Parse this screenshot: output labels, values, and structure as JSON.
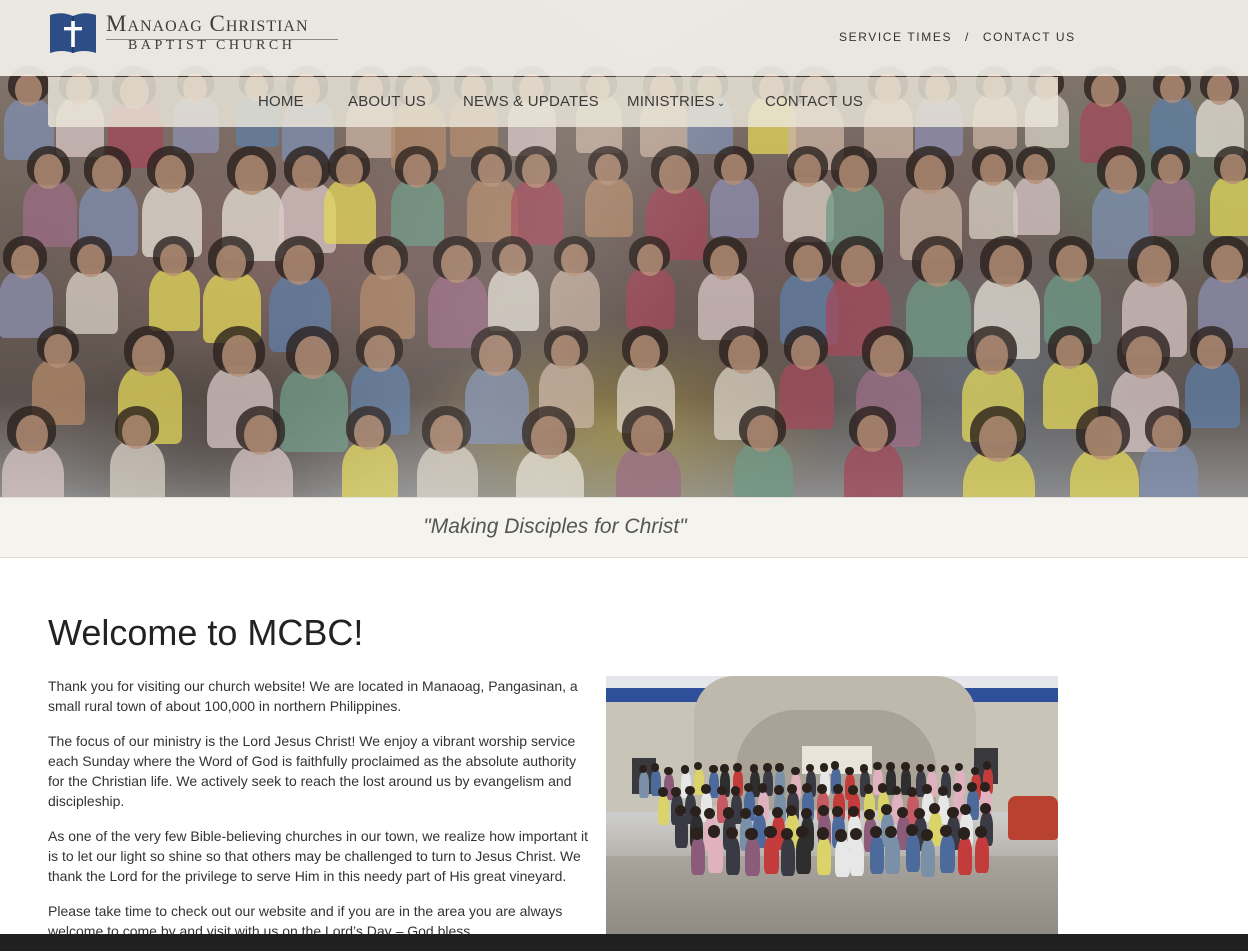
{
  "site": {
    "logo_line1": "Manaoag Christian",
    "logo_line2": "BAPTIST CHURCH"
  },
  "utility_nav": {
    "service_times": "SERVICE TIMES",
    "separator": "/",
    "contact_us": "CONTACT US"
  },
  "main_nav": {
    "items": [
      {
        "label": "HOME"
      },
      {
        "label": "ABOUT US"
      },
      {
        "label": "NEWS & UPDATES"
      },
      {
        "label": "MINISTRIES"
      },
      {
        "label": "CONTACT US"
      }
    ],
    "dropdown_indicator": "⌄"
  },
  "tagline": "\"Making Disciples for Christ\"",
  "welcome": {
    "title": "Welcome to MCBC!",
    "paragraphs": [
      "Thank you for visiting our church website! We are located in Manaoag, Pangasinan, a small rural town of about 100,000  in northern Philippines.",
      "The focus of our ministry is the Lord Jesus Christ! We enjoy a vibrant worship service each Sunday where the Word of God is faithfully proclaimed as the absolute authority for the Christian life. We actively seek to reach the lost around us by evangelism and discipleship.",
      "As one of the very few Bible-believing churches in our town, we realize how important it is to let our light so shine so that others may be challenged to turn to Jesus Christ. We thank the Lord for the privilege to serve Him in this needy part of His great vineyard.",
      "Please take time to check out our website and if you are in the area you are always welcome to come by and visit with us on the Lord’s Day – God bless."
    ]
  },
  "colors": {
    "logo_blue": "#2c4d86",
    "nav_bg": "#ece8da",
    "tagline_bg": "#f4f3ee",
    "roof_blue": "#2f4f9a"
  },
  "icons": {
    "logo": "bible-cross-icon",
    "dropdown": "chevron-down-icon"
  }
}
